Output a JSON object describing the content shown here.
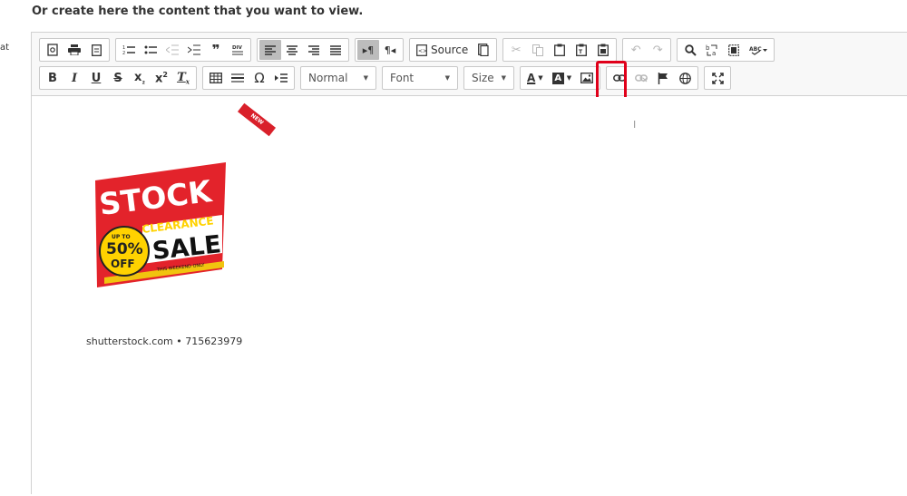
{
  "page": {
    "heading": "Or create here the content that you want to view.",
    "side_fragment": "at"
  },
  "toolbar": {
    "row1": {
      "source_label": "Source"
    },
    "row2": {
      "format_value": "Normal",
      "font_value": "Font",
      "size_value": "Size",
      "highlighted_button": "image-button"
    }
  },
  "content": {
    "ribbon_text": "NEW",
    "banner": {
      "stock": "STOCK",
      "clearance": "CLEARANCE",
      "sale": "SALE",
      "up_to": "UP TO",
      "percent": "50%",
      "off": "OFF",
      "footer": "THIS WEEKEND ONLY"
    },
    "caption": "shutterstock.com • 715623979"
  },
  "colors": {
    "highlight_box": "#e0001a",
    "banner_red": "#e3232b",
    "badge_yellow": "#ffd200"
  }
}
